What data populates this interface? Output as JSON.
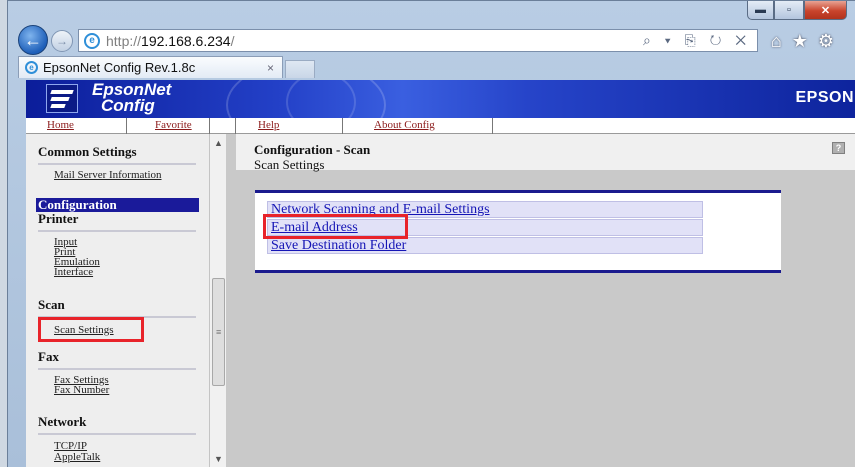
{
  "browser": {
    "url_prefix": "http://",
    "url_host": "192.168.6.234",
    "url_suffix": "/",
    "address_tools": "⌕ ▾ ⎘ ↻ ✕",
    "tab_title": "EpsonNet Config Rev.1.8c",
    "tab_close": "×",
    "window_buttons": {
      "minimize": "▬",
      "maximize": "▫",
      "close": "✕"
    },
    "toolbar": {
      "home": "⌂",
      "favorites": "★",
      "settings": "⚙"
    }
  },
  "banner": {
    "brand_line1": "EpsonNet",
    "brand_line2": "Config",
    "brand_right": "EPSON"
  },
  "menu": {
    "home": "Home",
    "favorite": "Favorite",
    "help": "Help",
    "about": "About Config"
  },
  "sidebar": {
    "common_settings": "Common Settings",
    "mail_server_information": "Mail Server Information",
    "configuration": "Configuration",
    "printer": "Printer",
    "printer_items": [
      "Input",
      "Print",
      "Emulation",
      "Interface"
    ],
    "scan": "Scan",
    "scan_settings": "Scan Settings",
    "fax": "Fax",
    "fax_items": [
      "Fax Settings",
      "Fax Number"
    ],
    "network": "Network",
    "network_items": [
      "TCP/IP",
      "AppleTalk"
    ]
  },
  "main": {
    "title": "Configuration - Scan",
    "subtitle": "Scan Settings",
    "help_icon_label": "?",
    "links": [
      "Network Scanning and E-mail Settings",
      "E-mail Address",
      "Save Destination Folder"
    ]
  },
  "colors": {
    "highlight_box": "#e8232a",
    "banner_blue": "#1a1a9a",
    "link_blue": "#1515b5"
  }
}
